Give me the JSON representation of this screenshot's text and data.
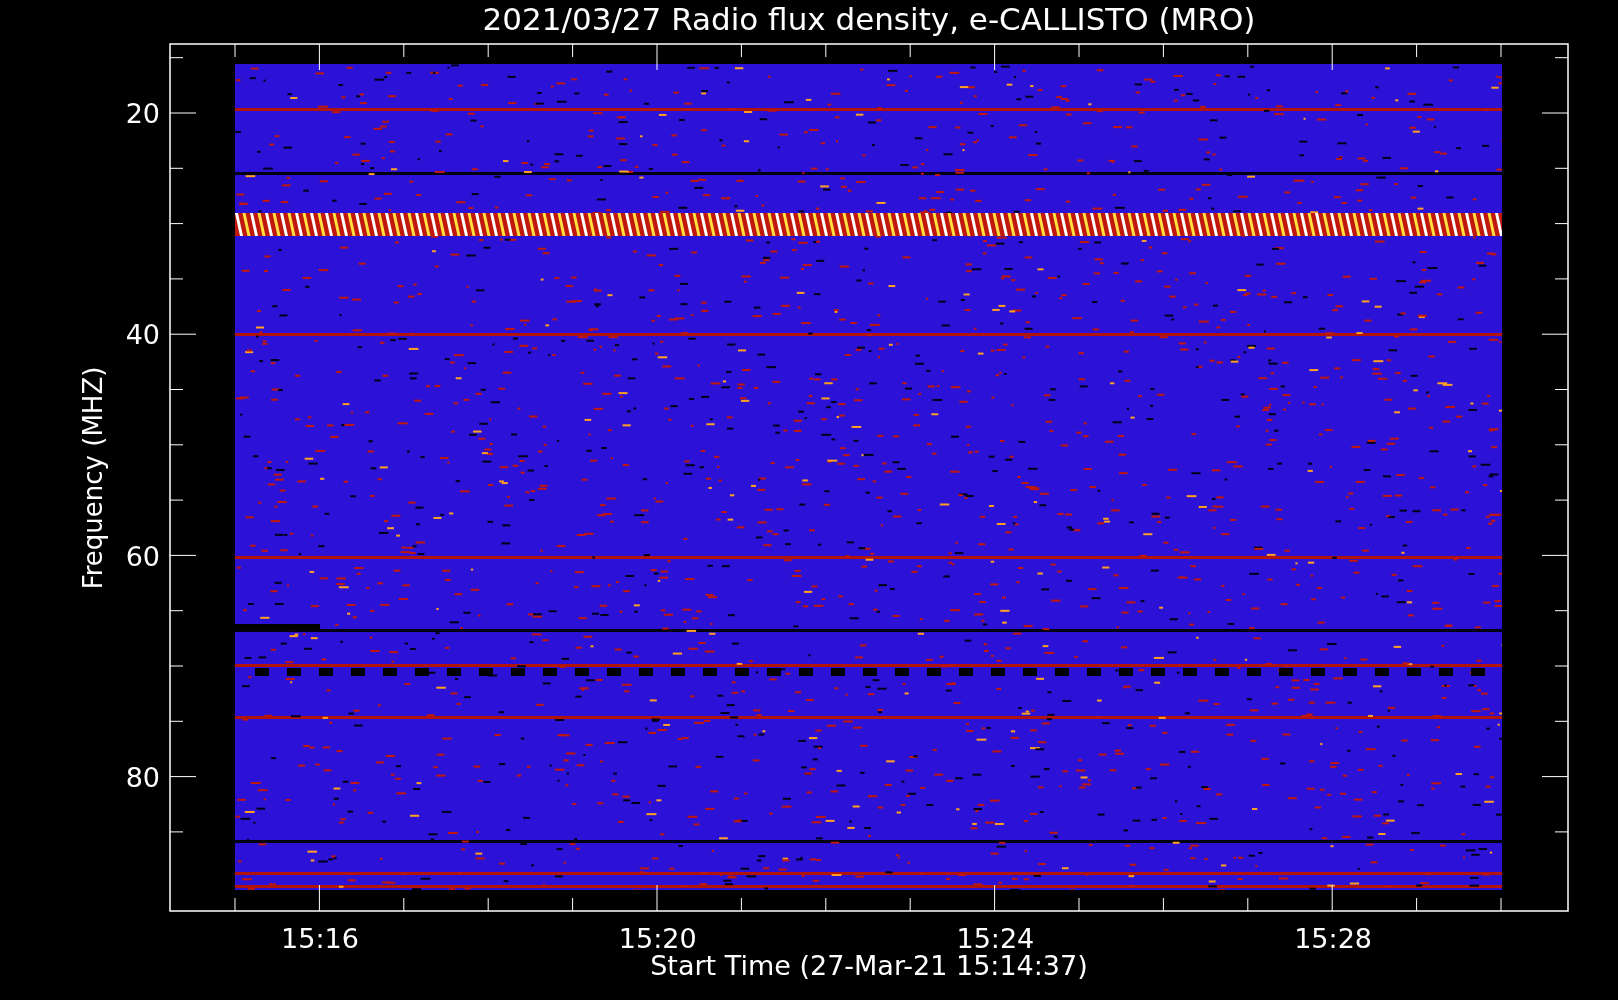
{
  "title": "2021/03/27  Radio flux density, e-CALLISTO (MRO)",
  "y_axis": {
    "label": "Frequency (MHZ)",
    "ticks": [
      "20",
      "40",
      "60",
      "80"
    ]
  },
  "x_axis": {
    "label": "Start Time (27-Mar-21 15:14:37)",
    "ticks": [
      "15:16",
      "15:20",
      "15:24",
      "15:28"
    ]
  }
}
